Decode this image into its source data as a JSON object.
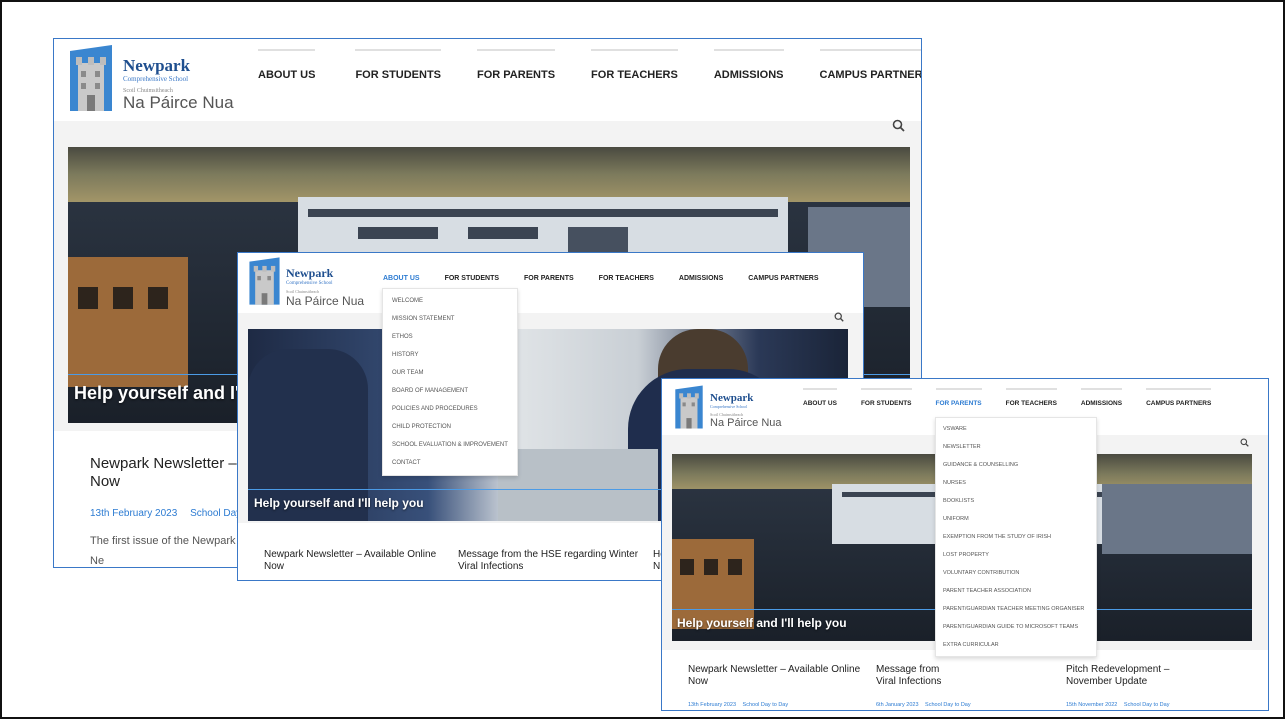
{
  "nav": [
    "About Us",
    "For Students",
    "For Parents",
    "For Teachers",
    "Admissions",
    "Campus Partners"
  ],
  "brand": {
    "name": "Newpark",
    "subtitle": "Comprehensive School",
    "irish_small": "Scoil Chuimsitheach",
    "irish": "Na Páirce Nua"
  },
  "hero_caption": "Help yourself and I'll help you",
  "screenshot1": {
    "caption_visible": "Help yourself and I'll h",
    "post": {
      "title": "Newpark Newsletter – A\nNow",
      "date": "13th February 2023",
      "category": "School Day to",
      "excerpt": "The first issue of the Newpark Ne\nacademic year is available now"
    }
  },
  "screenshot2": {
    "active_nav": "About Us",
    "about_menu": [
      "Welcome",
      "Mission Statement",
      "Ethos",
      "History",
      "Our Team",
      "Board of Management",
      "Policies and Procedures",
      "Child Protection",
      "School Evaluation & Improvement",
      "Contact"
    ],
    "posts": [
      "Newpark Newsletter – Available Online\nNow",
      "Message from the HSE regarding Winter\nViral Infections",
      "Ho\nN"
    ]
  },
  "screenshot3": {
    "active_nav": "For Parents",
    "parents_menu": [
      "VSware",
      "Newsletter",
      "Guidance & Counselling",
      "Nurses",
      "Booklists",
      "Uniform",
      "Exemption from the Study of Irish",
      "Lost Property",
      "Voluntary Contribution",
      "Parent Teacher Association",
      "Parent/Guardian Teacher Meeting Organiser",
      "Parent/Guardian Guide to Microsoft Teams",
      "Extra Curricular"
    ],
    "posts": [
      {
        "title": "Newpark Newsletter – Available Online\nNow",
        "date": "13th February 2023",
        "category": "School Day to Day"
      },
      {
        "title": "Message from\nViral Infections",
        "date": "6th January 2023",
        "category": "School Day to Day"
      },
      {
        "title": "Pitch Redevelopment –\nNovember Update",
        "date": "15th November 2022",
        "category": "School Day to Day"
      }
    ]
  },
  "colors": {
    "accent": "#2c7bd2",
    "brand": "#1f4f8f",
    "border": "#3a78c7"
  },
  "icons": {
    "search": "search-icon",
    "logo": "castle-tower-logo"
  }
}
